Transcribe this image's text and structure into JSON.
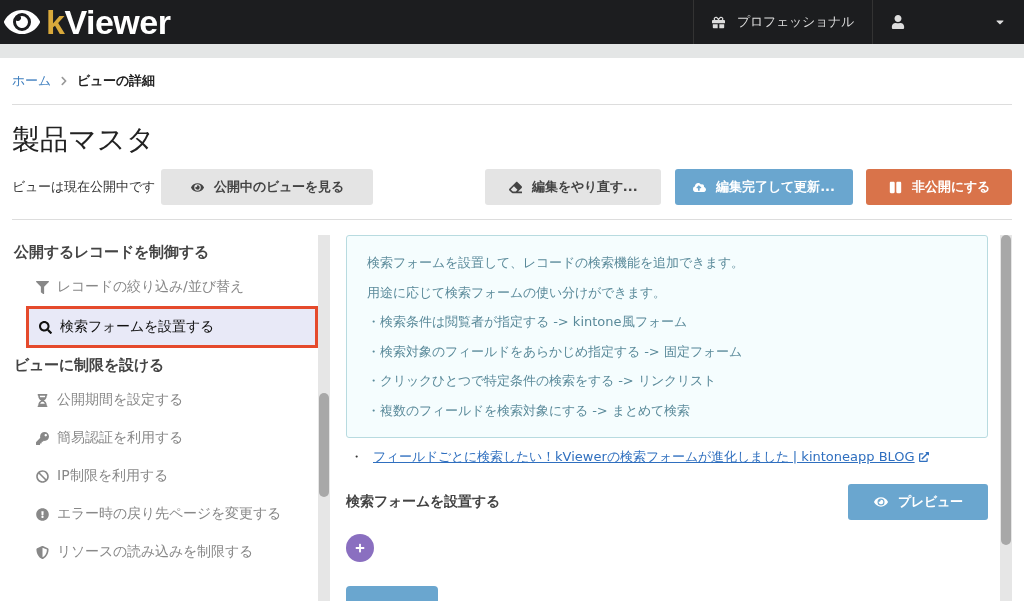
{
  "header": {
    "logo_prefix": "k",
    "logo_rest": "Viewer",
    "plan": "プロフェッショナル"
  },
  "breadcrumb": [
    {
      "label": "ホーム",
      "kind": "link"
    },
    {
      "label": "ビューの詳細",
      "kind": "current"
    }
  ],
  "title": "製品マスタ",
  "status_text": "ビューは現在公開中です",
  "actions": [
    {
      "label": "公開中のビューを見る",
      "kind": "view"
    },
    {
      "label": "編集をやり直す...",
      "kind": "secondary"
    },
    {
      "label": "編集完了して更新...",
      "kind": "primary"
    },
    {
      "label": "非公開にする",
      "kind": "danger"
    }
  ],
  "sidebar": [
    {
      "heading": "公開するレコードを制御する",
      "items": [
        {
          "label": "レコードの絞り込み/並び替え",
          "selected": false
        },
        {
          "label": "検索フォームを設置する",
          "selected": true
        }
      ]
    },
    {
      "heading": "ビューに制限を設ける",
      "items": [
        {
          "label": "公開期間を設定する",
          "selected": false
        },
        {
          "label": "簡易認証を利用する",
          "selected": false
        },
        {
          "label": "IP制限を利用する",
          "selected": false
        },
        {
          "label": "エラー時の戻り先ページを変更する",
          "selected": false
        },
        {
          "label": "リソースの読み込みを制限する",
          "selected": false
        }
      ]
    }
  ],
  "info_lines": [
    "検索フォームを設置して、レコードの検索機能を追加できます。",
    "用途に応じて検索フォームの使い分けができます。",
    "・検索条件は閲覧者が指定する -> kintone風フォーム",
    "・検索対象のフィールドをあらかじめ指定する -> 固定フォーム",
    "・クリックひとつで特定条件の検索をする -> リンクリスト",
    "・複数のフィールドを検索対象にする -> まとめて検索"
  ],
  "blog_bullet": "・",
  "blog_link": "フィールドごとに検索したい！kViewerの検索フォームが進化しました | kintoneapp BLOG",
  "section_title": "検索フォームを設置する",
  "preview_button": "プレビュー"
}
